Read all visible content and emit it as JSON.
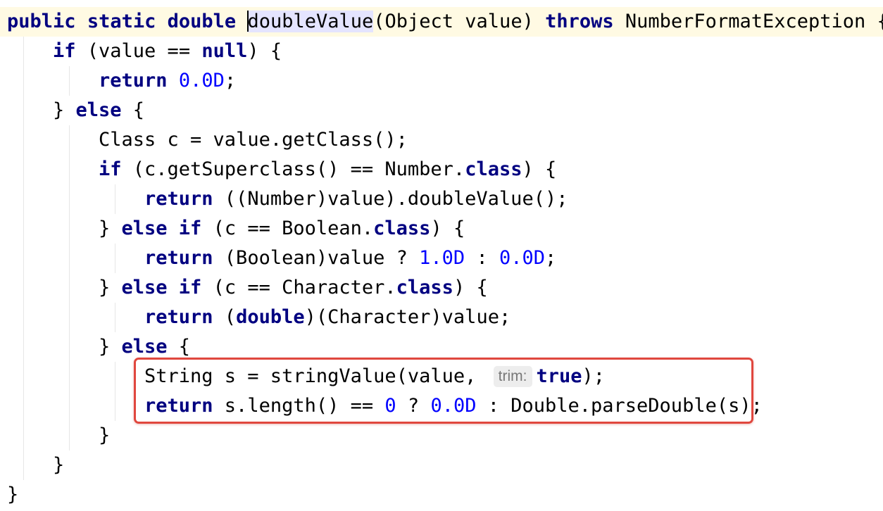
{
  "editor": {
    "caret_line": 0,
    "lines": [
      {
        "indent": 0,
        "tokens": [
          {
            "t": "public",
            "k": "kw"
          },
          {
            "t": " ",
            "k": "plain"
          },
          {
            "t": "static",
            "k": "kw"
          },
          {
            "t": " ",
            "k": "plain"
          },
          {
            "t": "double",
            "k": "kw"
          },
          {
            "t": " ",
            "k": "plain"
          },
          {
            "t": "doubleValue",
            "k": "plain hl-ident",
            "caret": true
          },
          {
            "t": "(Object value) ",
            "k": "plain"
          },
          {
            "t": "throws",
            "k": "kw"
          },
          {
            "t": " NumberFormatException {",
            "k": "plain"
          }
        ]
      },
      {
        "indent": 1,
        "tokens": [
          {
            "t": "if",
            "k": "kw"
          },
          {
            "t": " (value == ",
            "k": "plain"
          },
          {
            "t": "null",
            "k": "kw"
          },
          {
            "t": ") {",
            "k": "plain"
          }
        ]
      },
      {
        "indent": 2,
        "tokens": [
          {
            "t": "return",
            "k": "kw"
          },
          {
            "t": " ",
            "k": "plain"
          },
          {
            "t": "0.0D",
            "k": "num"
          },
          {
            "t": ";",
            "k": "plain"
          }
        ]
      },
      {
        "indent": 1,
        "tokens": [
          {
            "t": "} ",
            "k": "plain"
          },
          {
            "t": "else",
            "k": "kw"
          },
          {
            "t": " {",
            "k": "plain"
          }
        ]
      },
      {
        "indent": 2,
        "tokens": [
          {
            "t": "Class c = value.getClass();",
            "k": "plain"
          }
        ]
      },
      {
        "indent": 2,
        "tokens": [
          {
            "t": "if",
            "k": "kw"
          },
          {
            "t": " (c.getSuperclass() == Number.",
            "k": "plain"
          },
          {
            "t": "class",
            "k": "kw"
          },
          {
            "t": ") {",
            "k": "plain"
          }
        ]
      },
      {
        "indent": 3,
        "tokens": [
          {
            "t": "return",
            "k": "kw"
          },
          {
            "t": " ((Number)value).doubleValue();",
            "k": "plain"
          }
        ]
      },
      {
        "indent": 2,
        "tokens": [
          {
            "t": "} ",
            "k": "plain"
          },
          {
            "t": "else if",
            "k": "kw"
          },
          {
            "t": " (c == Boolean.",
            "k": "plain"
          },
          {
            "t": "class",
            "k": "kw"
          },
          {
            "t": ") {",
            "k": "plain"
          }
        ]
      },
      {
        "indent": 3,
        "tokens": [
          {
            "t": "return",
            "k": "kw"
          },
          {
            "t": " (Boolean)value ? ",
            "k": "plain"
          },
          {
            "t": "1.0D",
            "k": "num"
          },
          {
            "t": " : ",
            "k": "plain"
          },
          {
            "t": "0.0D",
            "k": "num"
          },
          {
            "t": ";",
            "k": "plain"
          }
        ]
      },
      {
        "indent": 2,
        "tokens": [
          {
            "t": "} ",
            "k": "plain"
          },
          {
            "t": "else if",
            "k": "kw"
          },
          {
            "t": " (c == Character.",
            "k": "plain"
          },
          {
            "t": "class",
            "k": "kw"
          },
          {
            "t": ") {",
            "k": "plain"
          }
        ]
      },
      {
        "indent": 3,
        "tokens": [
          {
            "t": "return",
            "k": "kw"
          },
          {
            "t": " (",
            "k": "plain"
          },
          {
            "t": "double",
            "k": "kw"
          },
          {
            "t": ")(Character)value;",
            "k": "plain"
          }
        ]
      },
      {
        "indent": 2,
        "tokens": [
          {
            "t": "} ",
            "k": "plain"
          },
          {
            "t": "else",
            "k": "kw"
          },
          {
            "t": " {",
            "k": "plain"
          }
        ]
      },
      {
        "indent": 3,
        "tokens": [
          {
            "t": "String s = stringValue(value, ",
            "k": "plain"
          },
          {
            "t": "trim:",
            "k": "hint"
          },
          {
            "t": "true",
            "k": "kw"
          },
          {
            "t": ");",
            "k": "plain"
          }
        ]
      },
      {
        "indent": 3,
        "tokens": [
          {
            "t": "return",
            "k": "kw"
          },
          {
            "t": " s.length() == ",
            "k": "plain"
          },
          {
            "t": "0",
            "k": "num"
          },
          {
            "t": " ? ",
            "k": "plain"
          },
          {
            "t": "0.0D",
            "k": "num"
          },
          {
            "t": " : Double.parseDouble(s);",
            "k": "plain"
          }
        ]
      },
      {
        "indent": 2,
        "tokens": [
          {
            "t": "}",
            "k": "plain"
          }
        ]
      },
      {
        "indent": 1,
        "tokens": [
          {
            "t": "}",
            "k": "plain"
          }
        ]
      },
      {
        "indent": 0,
        "tokens": [
          {
            "t": "}",
            "k": "plain"
          }
        ]
      }
    ]
  },
  "colors": {
    "keyword": "#000080",
    "number": "#0000ff",
    "current_line": "#fffae3",
    "identifier_highlight": "#e4e4ff",
    "annotation_border": "#e0473e",
    "hint_background": "#ededed"
  }
}
